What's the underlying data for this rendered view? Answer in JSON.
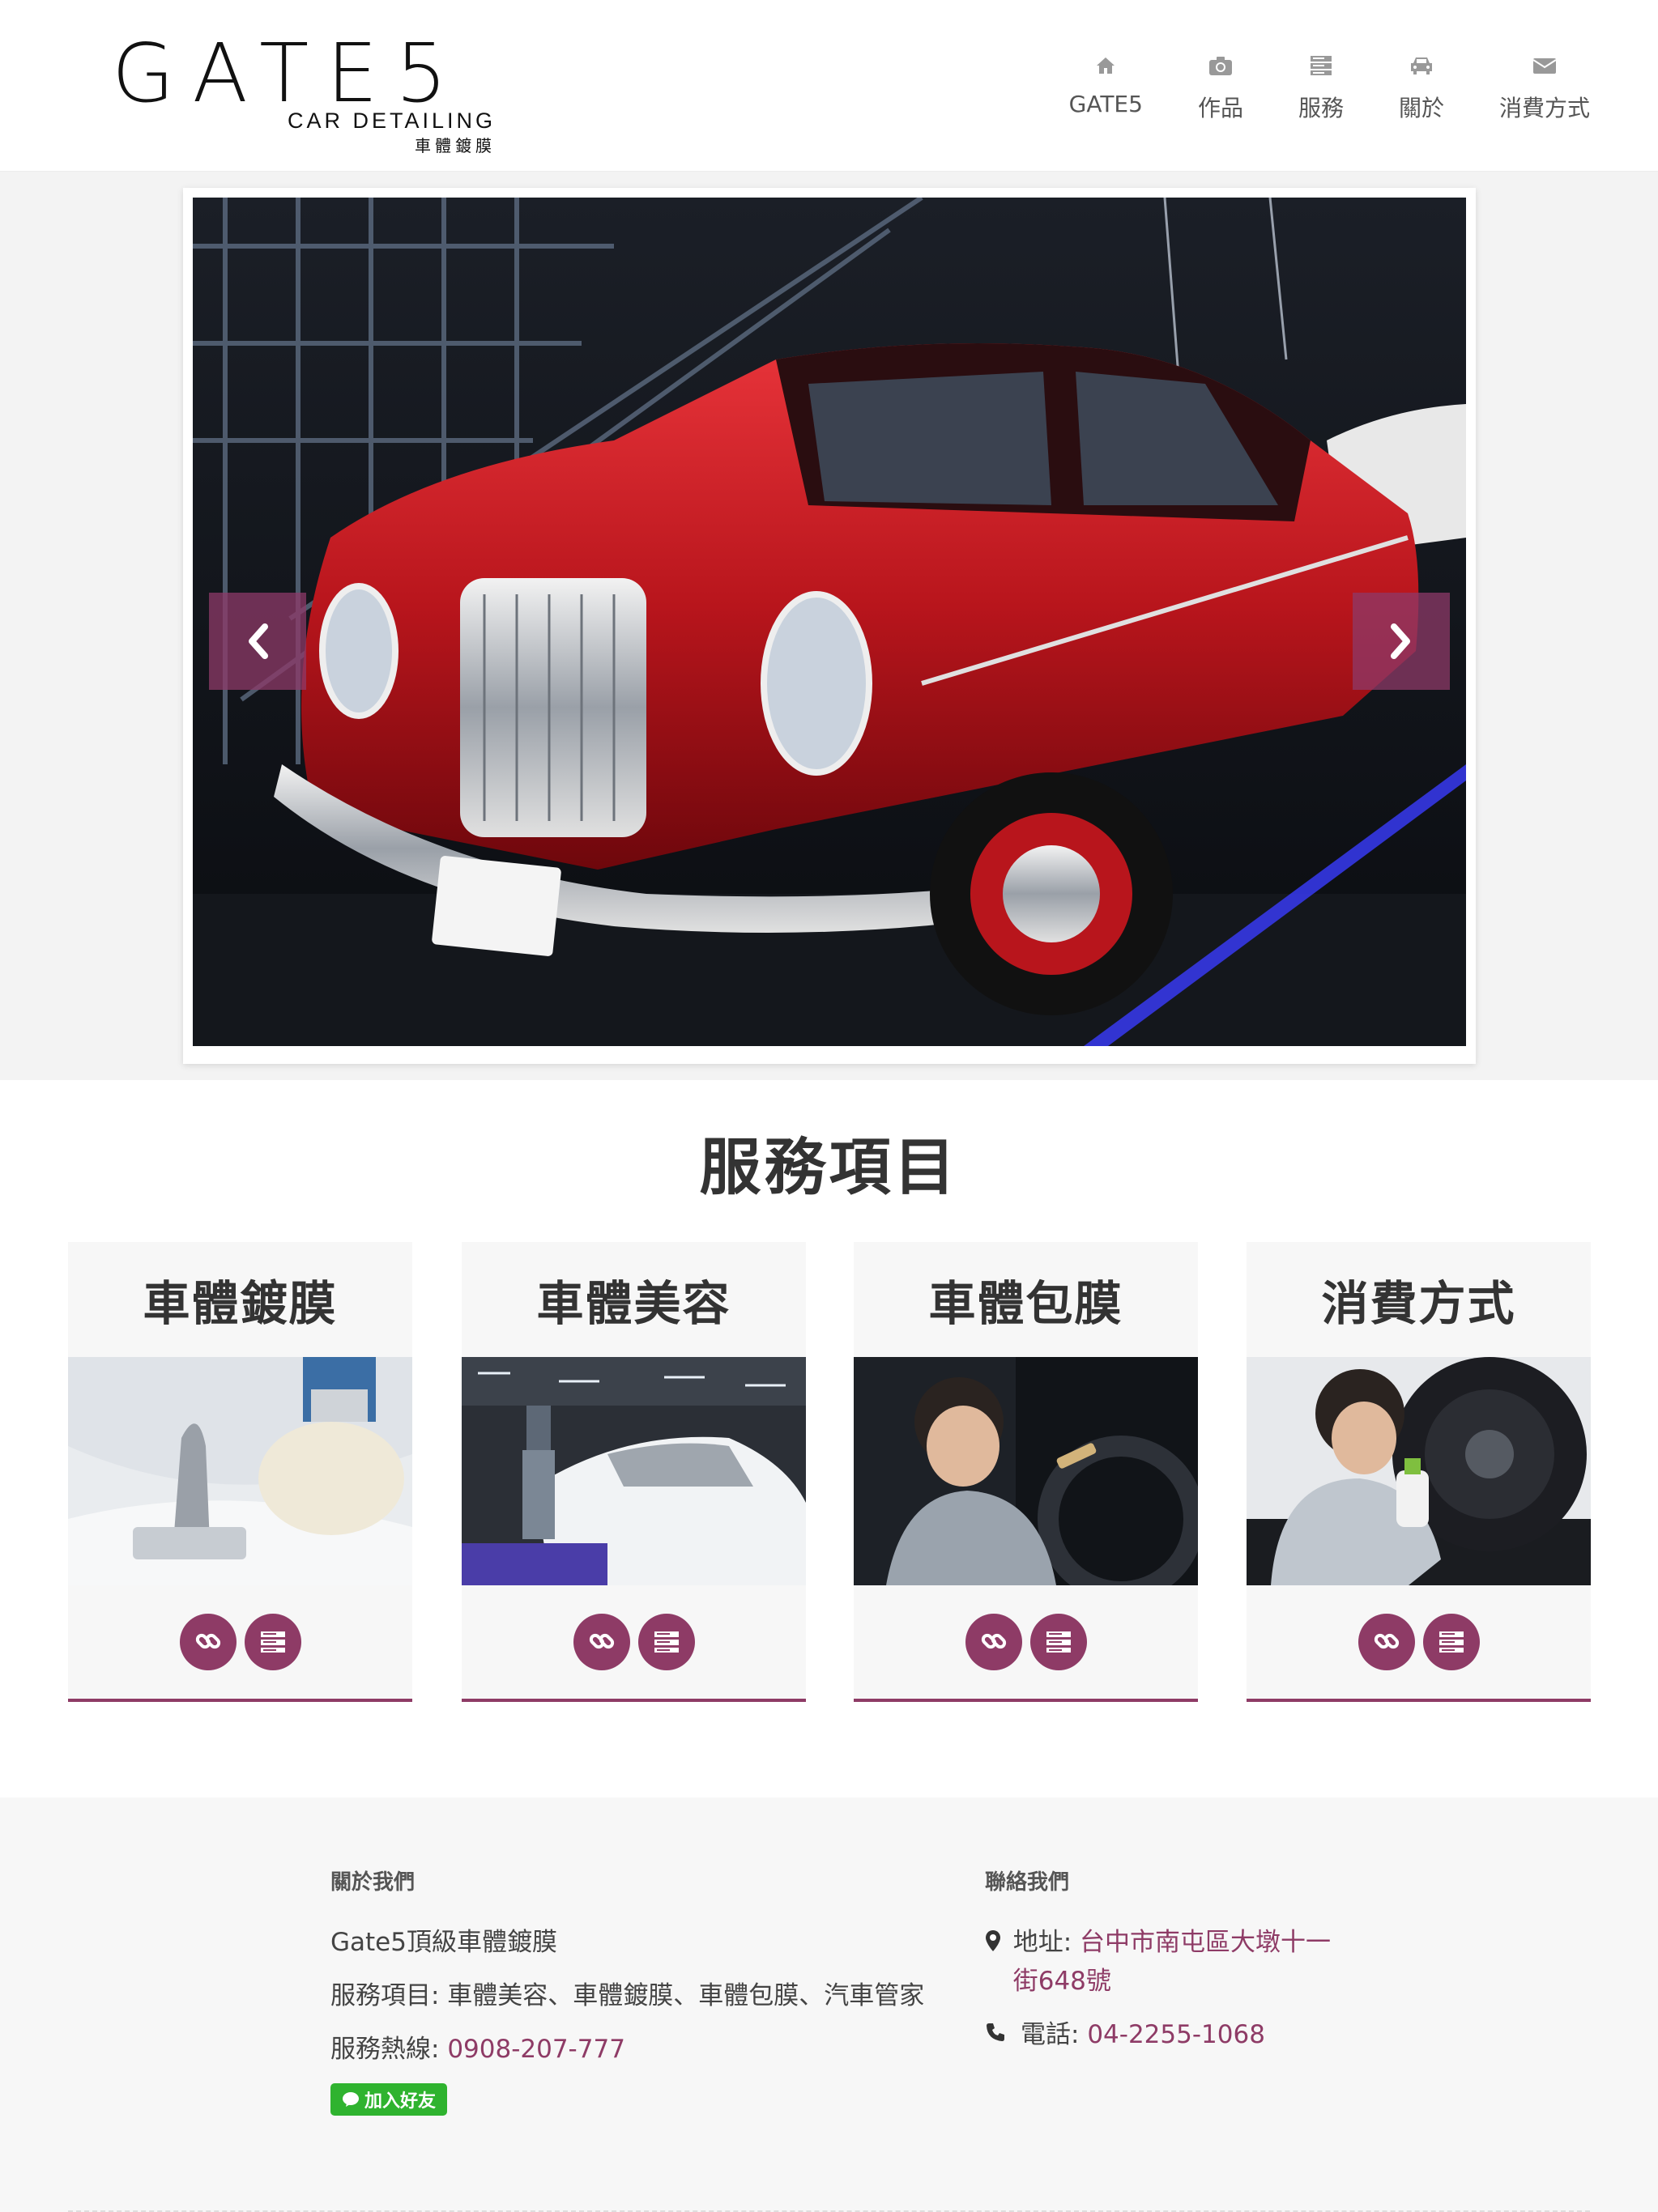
{
  "brand": {
    "logo_main": "GATE5",
    "logo_sub": "CAR DETAILING",
    "logo_sub2": "車體鍍膜"
  },
  "nav": [
    {
      "label": "GATE5",
      "icon": "home-icon"
    },
    {
      "label": "作品",
      "icon": "camera-icon"
    },
    {
      "label": "服務",
      "icon": "server-icon"
    },
    {
      "label": "關於",
      "icon": "car-icon"
    },
    {
      "label": "消費方式",
      "icon": "envelope-icon"
    }
  ],
  "carousel": {
    "prev_icon": "chevron-left-icon",
    "next_icon": "chevron-right-icon"
  },
  "services": {
    "title": "服務項目",
    "cards": [
      {
        "title": "車體鍍膜"
      },
      {
        "title": "車體美容"
      },
      {
        "title": "車體包膜"
      },
      {
        "title": "消費方式"
      }
    ]
  },
  "footer": {
    "about_heading": "關於我們",
    "company": "Gate5頂級車體鍍膜",
    "services_text": "服務項目: 車體美容、車體鍍膜、車體包膜、汽車管家",
    "hotline_label": "服務熱線: ",
    "hotline": "0908-207-777",
    "line_button": "加入好友",
    "contact_heading": "聯絡我們",
    "address_label": "地址: ",
    "address": "台中市南屯區大墩十一街648號",
    "phone_label": "電話: ",
    "phone": "04-2255-1068"
  },
  "colors": {
    "accent": "#8e3b66",
    "line_green": "#2fb32f"
  }
}
